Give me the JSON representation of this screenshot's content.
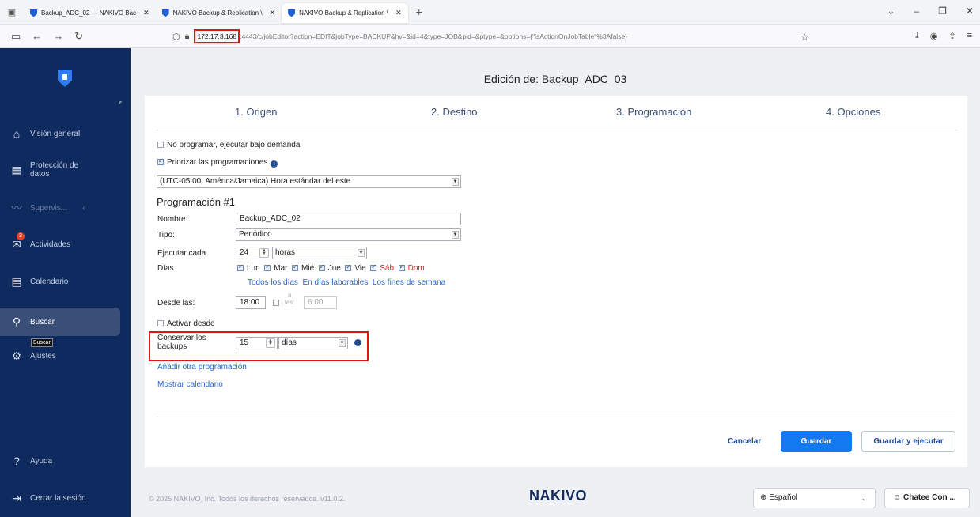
{
  "browser": {
    "tabs": [
      {
        "title": "Backup_ADC_02 — NAKIVO Bac"
      },
      {
        "title": "NAKIVO Backup & Replication \\"
      },
      {
        "title": "NAKIVO Backup & Replication \\"
      }
    ],
    "url_host": "172.17.3.168",
    "url_rest": ":4443/c/jobEditor?action=EDIT&jobType=BACKUP&hv=&id=4&type=JOB&pid=&ptype=&options={\"isActionOnJobTable\"%3Afalse}"
  },
  "sidebar": {
    "items": [
      {
        "label": "Visión general",
        "icon": "home-icon"
      },
      {
        "label": "Protección de datos",
        "icon": "grid-icon"
      },
      {
        "label": "Supervis...",
        "icon": "monitor-icon"
      },
      {
        "label": "Actividades",
        "icon": "activities-icon",
        "badge": "3"
      },
      {
        "label": "Calendario",
        "icon": "calendar-icon"
      },
      {
        "label": "Buscar",
        "icon": "search-icon"
      },
      {
        "label": "Ajustes",
        "icon": "gear-icon"
      },
      {
        "label": "Ayuda",
        "icon": "help-icon"
      },
      {
        "label": "Cerrar la sesión",
        "icon": "logout-icon"
      }
    ],
    "tooltip": "Buscar"
  },
  "page": {
    "title": "Edición de: Backup_ADC_03",
    "steps": [
      "1. Origen",
      "2. Destino",
      "3. Programación",
      "4. Opciones"
    ]
  },
  "form": {
    "no_schedule": "No programar, ejecutar bajo demanda",
    "prioritize": "Priorizar las programaciones",
    "timezone": "(UTC-05:00, América/Jamaica) Hora estándar del este",
    "schedule_title": "Programación #1",
    "name_label": "Nombre:",
    "name_value": "Backup_ADC_02",
    "type_label": "Tipo:",
    "type_value": "Periódico",
    "every_label": "Ejecutar cada",
    "every_value": "24",
    "every_unit": "horas",
    "days_label": "Días",
    "days": [
      {
        "label": "Lun",
        "weekend": false
      },
      {
        "label": "Mar",
        "weekend": false
      },
      {
        "label": "Mié",
        "weekend": false
      },
      {
        "label": "Jue",
        "weekend": false
      },
      {
        "label": "Vie",
        "weekend": false
      },
      {
        "label": "Sáb",
        "weekend": true
      },
      {
        "label": "Dom",
        "weekend": true
      }
    ],
    "day_links": [
      "Todos los días",
      "En días laborables",
      "Los fines de semana"
    ],
    "from_label": "Desde las:",
    "from_value": "18:00",
    "to_label_a": "a",
    "to_label_b": "las:",
    "to_value": "6:00",
    "activate_from": "Activar desde",
    "retain_label": "Conservar los backups",
    "retain_value": "15",
    "retain_unit": "días",
    "add_schedule": "Añadir otra programación",
    "show_calendar": "Mostrar calendario"
  },
  "actions": {
    "cancel": "Cancelar",
    "save": "Guardar",
    "save_run": "Guardar y ejecutar"
  },
  "footer": {
    "copyright": "© 2025 NAKIVO, Inc. Todos los derechos reservados. v11.0.2.",
    "logo": "NAKIVO",
    "language": "Español",
    "chat": "Chatee Con ..."
  }
}
